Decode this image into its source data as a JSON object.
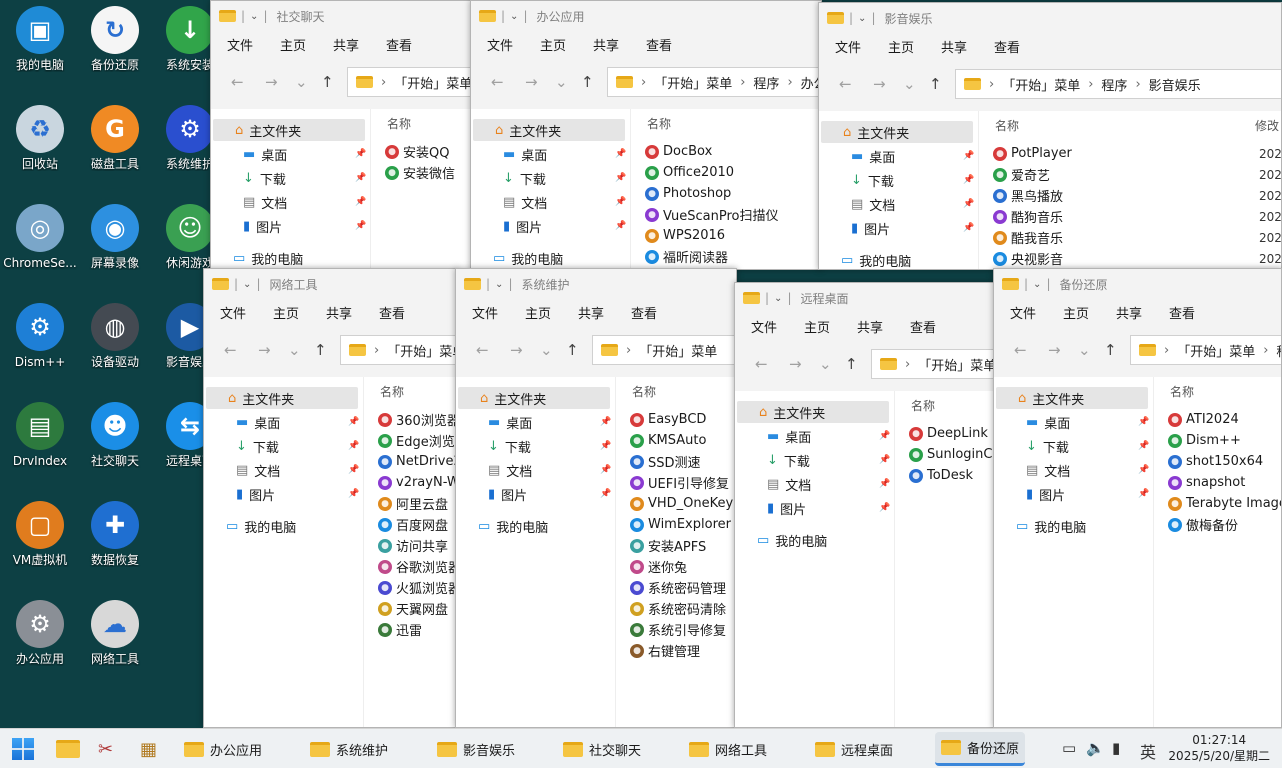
{
  "desktop": {
    "icons": [
      {
        "label": "我的电脑",
        "name": "my-computer-icon",
        "glyph": "▣",
        "color": "#1f8bd6"
      },
      {
        "label": "备份还原",
        "name": "backup-restore-icon",
        "glyph": "↻",
        "color": "#f5f5f5"
      },
      {
        "label": "系统安装",
        "name": "system-install-icon",
        "glyph": "↓",
        "color": "#31a54a"
      },
      {
        "label": "回收站",
        "name": "recycle-bin-icon",
        "glyph": "♻",
        "color": "#c9d6df"
      },
      {
        "label": "磁盘工具",
        "name": "disk-tool-icon",
        "glyph": "G",
        "color": "#f08a24"
      },
      {
        "label": "系统维护",
        "name": "system-maintenance-icon",
        "glyph": "⚙",
        "color": "#2a4fcf"
      },
      {
        "label": "ChromeSe...",
        "name": "chrome-setup-icon",
        "glyph": "◎",
        "color": "#7aa6c9"
      },
      {
        "label": "屏幕录像",
        "name": "screen-record-icon",
        "glyph": "◉",
        "color": "#2d90e0"
      },
      {
        "label": "休闲游戏",
        "name": "casual-game-icon",
        "glyph": "☺",
        "color": "#3aa052"
      },
      {
        "label": "Dism++",
        "name": "dism-icon",
        "glyph": "⚙",
        "color": "#1e7fd6"
      },
      {
        "label": "设备驱动",
        "name": "device-driver-icon",
        "glyph": "◍",
        "color": "#444a52"
      },
      {
        "label": "影音娱乐",
        "name": "media-entertainment-icon",
        "glyph": "▶",
        "color": "#1c5aa3"
      },
      {
        "label": "DrvIndex",
        "name": "drvindex-icon",
        "glyph": "▤",
        "color": "#2d7a3e"
      },
      {
        "label": "社交聊天",
        "name": "social-chat-icon",
        "glyph": "☻",
        "color": "#1b8ee6"
      },
      {
        "label": "远程桌面",
        "name": "remote-desktop-icon",
        "glyph": "⇆",
        "color": "#1a8fe8"
      },
      {
        "label": "VM虚拟机",
        "name": "vm-icon",
        "glyph": "▢",
        "color": "#e07c1e"
      },
      {
        "label": "数据恢复",
        "name": "data-recovery-icon",
        "glyph": "✚",
        "color": "#1f6fd1"
      },
      {
        "label": "办公应用",
        "name": "office-apps-icon",
        "glyph": "⚙",
        "color": "#8a8f96"
      },
      {
        "label": "网络工具",
        "name": "network-tool-icon",
        "glyph": "☁",
        "color": "#d8d8d8"
      }
    ]
  },
  "common": {
    "menu": [
      "文件",
      "主页",
      "共享",
      "查看"
    ],
    "nav": [
      "主文件夹",
      "桌面",
      "下载",
      "文档",
      "图片",
      "我的电脑"
    ],
    "name_col": "名称",
    "date_col": "修改",
    "crumb_start": "「开始」菜单",
    "crumb_prog": "程序"
  },
  "windows": {
    "social": {
      "title": "社交聊天",
      "files": [
        "安装QQ",
        "安装微信"
      ]
    },
    "office": {
      "title": "办公应用",
      "crumb_tail": "办公",
      "files": [
        "DocBox",
        "Office2010",
        "Photoshop",
        "VueScanPro扫描仪",
        "WPS2016",
        "福昕阅读器"
      ]
    },
    "media": {
      "title": "影音娱乐",
      "crumb_tail": "影音娱乐",
      "files": [
        "PotPlayer",
        "爱奇艺",
        "黑鸟播放",
        "酷狗音乐",
        "酷我音乐",
        "央视影音"
      ],
      "date": "2025"
    },
    "network": {
      "title": "网络工具",
      "files": [
        "360浏览器",
        "Edge浏览",
        "NetDrive2",
        "v2rayN-W",
        "阿里云盘",
        "百度网盘",
        "访问共享",
        "谷歌浏览器",
        "火狐浏览器",
        "天翼网盘",
        "迅雷"
      ]
    },
    "sysmaint": {
      "title": "系统维护",
      "files": [
        "EasyBCD",
        "KMSAuto",
        "SSD测速",
        "UEFI引导修复",
        "VHD_OneKey",
        "WimExplorer",
        "安装APFS",
        "迷你兔",
        "系统密码管理",
        "系统密码清除",
        "系统引导修复",
        "右键管理"
      ]
    },
    "remote": {
      "title": "远程桌面",
      "files": [
        "DeepLink",
        "SunloginCl",
        "ToDesk"
      ]
    },
    "backup": {
      "title": "备份还原",
      "crumb_tail": "程",
      "files": [
        "ATI2024",
        "Dism++",
        "shot150x64",
        "snapshot",
        "Terabyte Image",
        "傲梅备份"
      ]
    }
  },
  "taskbar": {
    "items": [
      {
        "label": "办公应用",
        "name": "taskbar-office-apps"
      },
      {
        "label": "系统维护",
        "name": "taskbar-system-maintenance"
      },
      {
        "label": "影音娱乐",
        "name": "taskbar-media-entertainment"
      },
      {
        "label": "社交聊天",
        "name": "taskbar-social-chat"
      },
      {
        "label": "网络工具",
        "name": "taskbar-network-tools"
      },
      {
        "label": "远程桌面",
        "name": "taskbar-remote-desktop"
      },
      {
        "label": "备份还原",
        "name": "taskbar-backup-restore",
        "active": true
      }
    ],
    "ime": "英",
    "time": "01:27:14",
    "date": "2025/5/20/星期二",
    "accent": "#3a86d9"
  }
}
